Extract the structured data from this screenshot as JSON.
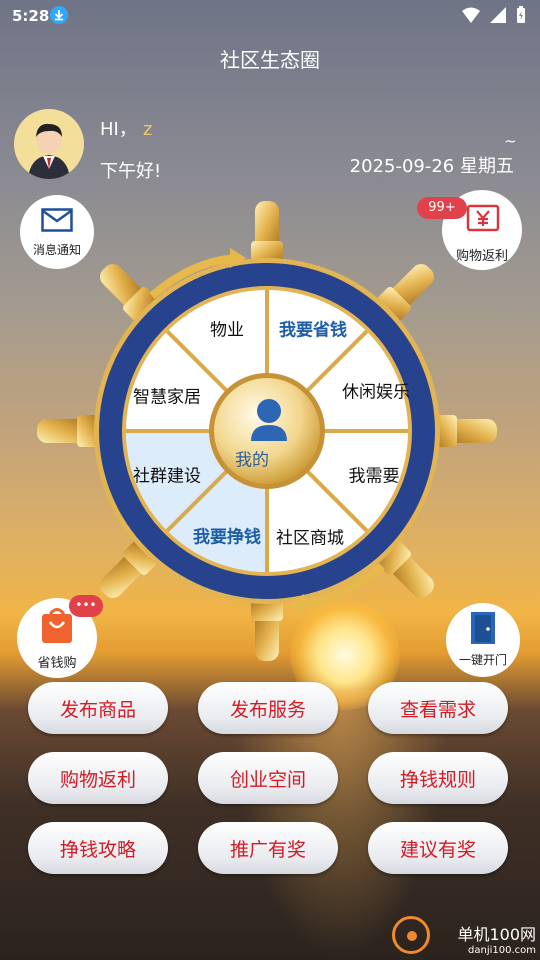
{
  "status_bar": {
    "time": "5:28"
  },
  "header": {
    "title": "社区生态圈"
  },
  "user": {
    "hi": "HI，",
    "name": "z",
    "greeting": "下午好!",
    "tilde": "~",
    "date": "2025-09-26 星期五"
  },
  "shortcuts": {
    "message": "消息通知",
    "shopping_rebate": "购物返利",
    "shopping_badge": "99+",
    "save_shop": "省钱购",
    "save_badge": "•••",
    "door": "一键开门"
  },
  "wheel": {
    "center": "我的",
    "segments": [
      "物业",
      "我要省钱",
      "休闲娱乐",
      "我需要",
      "社区商城",
      "我要挣钱",
      "社群建设",
      "智慧家居"
    ]
  },
  "grid_buttons": [
    "发布商品",
    "发布服务",
    "查看需求",
    "购物返利",
    "创业空间",
    "挣钱规则",
    "挣钱攻略",
    "推广有奖",
    "建议有奖"
  ],
  "watermark": {
    "text": "单机100网",
    "url": "danji100.com"
  }
}
